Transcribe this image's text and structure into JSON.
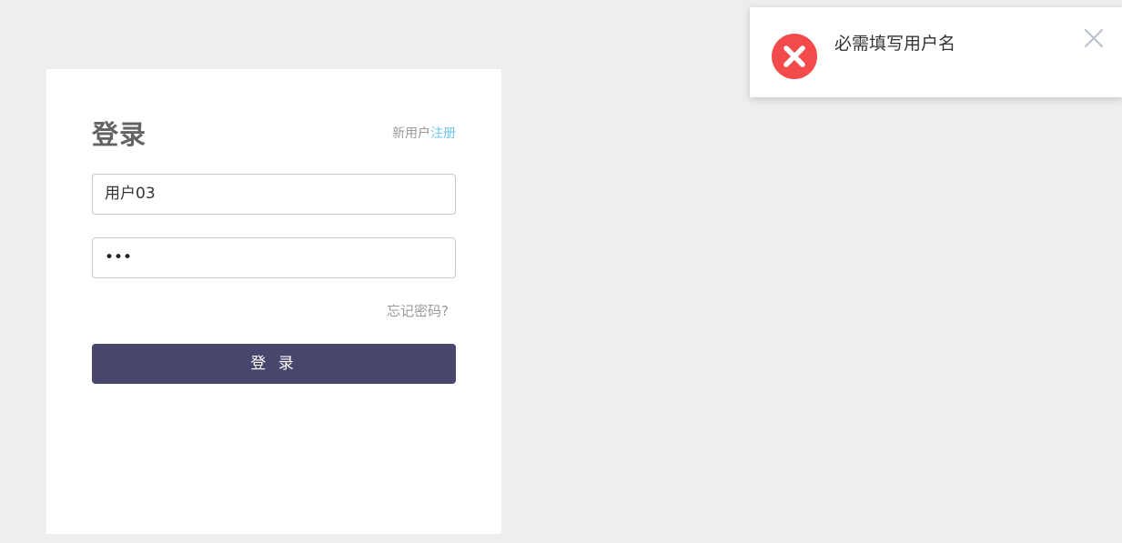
{
  "login": {
    "title": "登录",
    "register_prefix": "新用户",
    "register_link": "注册",
    "username_value": "用户03",
    "password_masked": "•••",
    "forgot_password": "忘记密码?",
    "submit_label": "登 录"
  },
  "toast": {
    "type": "error",
    "message": "必需填写用户名",
    "icon": "error-x-circle-icon",
    "close_icon": "close-icon"
  },
  "colors": {
    "background": "#eeeeee",
    "button": "#48466d",
    "link": "#6dc5f0",
    "error": "#f34b4b"
  }
}
